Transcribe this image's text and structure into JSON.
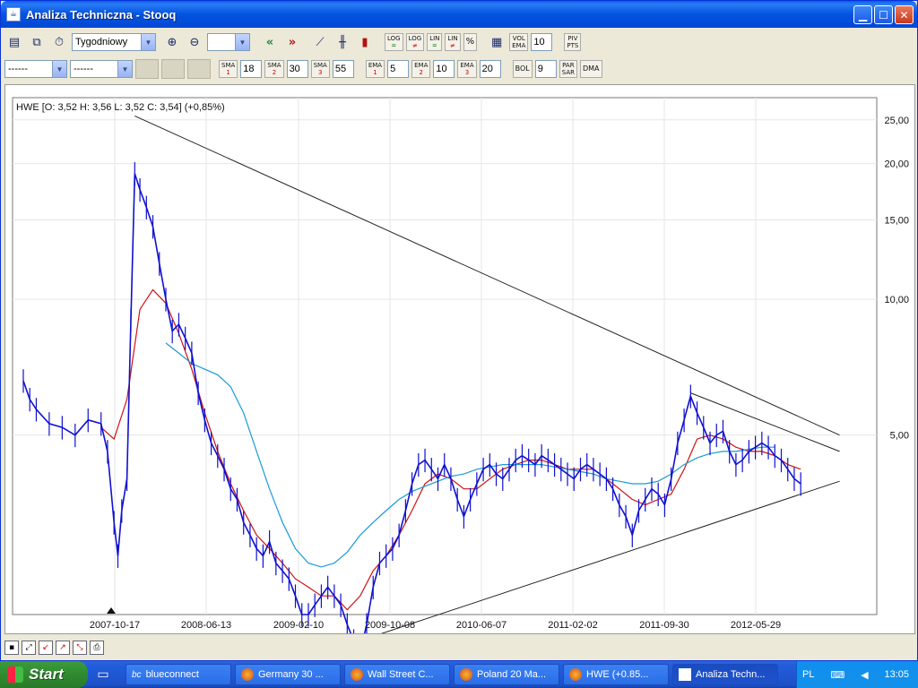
{
  "window": {
    "title": "Analiza Techniczna - Stooq"
  },
  "toolbar": {
    "interval": "Tygodniowy",
    "vol_ema_label_top": "VOL",
    "vol_ema_label_bottom": "EMA",
    "vol_ema_value": "10",
    "piv_label_top": "PIV",
    "piv_label_bottom": "PTS",
    "log1_top": "LOG",
    "log1_bottom": "=",
    "log2_top": "LOG",
    "log2_bottom": "≠",
    "lin1_top": "LIN",
    "lin1_bottom": "=",
    "lin2_top": "LIN",
    "lin2_bottom": "≠",
    "pct": "%"
  },
  "toolbar2": {
    "select1": "------",
    "select2": "------",
    "sma1": {
      "label": "SMA",
      "idx": "1",
      "value": "18"
    },
    "sma2": {
      "label": "SMA",
      "idx": "2",
      "value": "30"
    },
    "sma3": {
      "label": "SMA",
      "idx": "3",
      "value": "55"
    },
    "ema1": {
      "label": "EMA",
      "idx": "1",
      "value": "5"
    },
    "ema2": {
      "label": "EMA",
      "idx": "2",
      "value": "10"
    },
    "ema3": {
      "label": "EMA",
      "idx": "3",
      "value": "20"
    },
    "bol": {
      "label": "BOL",
      "value": "9"
    },
    "parsar_top": "PAR",
    "parsar_bottom": "SAR",
    "dma": "DMA"
  },
  "chart": {
    "legend": "HWE [O: 3,52  H: 3,56  L: 3,52  C: 3,54] (+0,85%)",
    "y_ticks": [
      "25,00",
      "20,00",
      "15,00",
      "10,00",
      "5,00"
    ],
    "x_ticks": [
      "2007-10-17",
      "2008-06-13",
      "2009-02-10",
      "2009-10-08",
      "2010-06-07",
      "2011-02-02",
      "2011-09-30",
      "2012-05-29"
    ]
  },
  "chart_data": {
    "type": "line",
    "title": "",
    "symbol": "HWE",
    "scale": "log",
    "ylim": [
      2.0,
      28.0
    ],
    "yticks": [
      25.0,
      20.0,
      15.0,
      10.0,
      5.0
    ],
    "xlabel": "",
    "ylabel": "",
    "x_ticks": [
      "2007-10-17",
      "2008-06-13",
      "2009-02-10",
      "2009-10-08",
      "2010-06-07",
      "2011-02-02",
      "2011-09-30",
      "2012-05-29"
    ],
    "ohlc_last": {
      "O": 3.52,
      "H": 3.56,
      "L": 3.52,
      "C": 3.54,
      "change_pct": 0.85
    },
    "series": [
      {
        "color": "#1010d0",
        "kind": "price",
        "points": [
          [
            0,
            6.6
          ],
          [
            5,
            6.0
          ],
          [
            10,
            5.7
          ],
          [
            20,
            5.3
          ],
          [
            30,
            5.2
          ],
          [
            40,
            5.0
          ],
          [
            50,
            5.4
          ],
          [
            60,
            5.3
          ],
          [
            65,
            4.6
          ],
          [
            70,
            3.2
          ],
          [
            73,
            2.7
          ],
          [
            76,
            3.4
          ],
          [
            80,
            4.0
          ],
          [
            83,
            9.0
          ],
          [
            86,
            19.0
          ],
          [
            90,
            17.5
          ],
          [
            95,
            16.0
          ],
          [
            100,
            14.5
          ],
          [
            105,
            12.0
          ],
          [
            110,
            10.0
          ],
          [
            115,
            8.5
          ],
          [
            120,
            8.8
          ],
          [
            125,
            8.2
          ],
          [
            130,
            7.6
          ],
          [
            135,
            6.2
          ],
          [
            140,
            5.4
          ],
          [
            145,
            4.8
          ],
          [
            150,
            4.5
          ],
          [
            155,
            4.2
          ],
          [
            160,
            3.8
          ],
          [
            165,
            3.6
          ],
          [
            170,
            3.2
          ],
          [
            175,
            3.0
          ],
          [
            180,
            2.8
          ],
          [
            185,
            2.7
          ],
          [
            190,
            2.9
          ],
          [
            195,
            2.6
          ],
          [
            200,
            2.5
          ],
          [
            205,
            2.4
          ],
          [
            210,
            2.2
          ],
          [
            215,
            2.0
          ],
          [
            220,
            2.0
          ],
          [
            225,
            2.1
          ],
          [
            230,
            2.2
          ],
          [
            235,
            2.3
          ],
          [
            240,
            2.2
          ],
          [
            245,
            2.1
          ],
          [
            250,
            1.9
          ],
          [
            255,
            1.75
          ],
          [
            260,
            1.65
          ],
          [
            265,
            1.9
          ],
          [
            270,
            2.3
          ],
          [
            275,
            2.6
          ],
          [
            280,
            2.7
          ],
          [
            285,
            2.8
          ],
          [
            290,
            3.0
          ],
          [
            295,
            3.4
          ],
          [
            300,
            3.9
          ],
          [
            305,
            4.3
          ],
          [
            310,
            4.4
          ],
          [
            315,
            4.2
          ],
          [
            320,
            4.0
          ],
          [
            325,
            4.3
          ],
          [
            330,
            4.0
          ],
          [
            335,
            3.6
          ],
          [
            340,
            3.3
          ],
          [
            345,
            3.6
          ],
          [
            350,
            3.9
          ],
          [
            355,
            4.2
          ],
          [
            360,
            4.3
          ],
          [
            365,
            4.1
          ],
          [
            370,
            4.0
          ],
          [
            375,
            4.2
          ],
          [
            380,
            4.4
          ],
          [
            385,
            4.5
          ],
          [
            390,
            4.4
          ],
          [
            395,
            4.3
          ],
          [
            400,
            4.5
          ],
          [
            405,
            4.4
          ],
          [
            410,
            4.3
          ],
          [
            415,
            4.2
          ],
          [
            420,
            4.1
          ],
          [
            425,
            4.0
          ],
          [
            430,
            4.2
          ],
          [
            435,
            4.3
          ],
          [
            440,
            4.2
          ],
          [
            445,
            4.1
          ],
          [
            450,
            4.0
          ],
          [
            455,
            3.8
          ],
          [
            460,
            3.5
          ],
          [
            465,
            3.3
          ],
          [
            470,
            3.0
          ],
          [
            475,
            3.4
          ],
          [
            480,
            3.6
          ],
          [
            485,
            3.8
          ],
          [
            490,
            3.7
          ],
          [
            495,
            3.5
          ],
          [
            500,
            4.0
          ],
          [
            505,
            4.8
          ],
          [
            510,
            5.4
          ],
          [
            515,
            6.1
          ],
          [
            520,
            5.6
          ],
          [
            525,
            5.2
          ],
          [
            530,
            4.8
          ],
          [
            535,
            5.0
          ],
          [
            540,
            5.1
          ],
          [
            545,
            4.6
          ],
          [
            550,
            4.3
          ],
          [
            555,
            4.4
          ],
          [
            560,
            4.6
          ],
          [
            565,
            4.7
          ],
          [
            570,
            4.8
          ],
          [
            575,
            4.7
          ],
          [
            580,
            4.5
          ],
          [
            585,
            4.4
          ],
          [
            590,
            4.2
          ],
          [
            595,
            4.0
          ],
          [
            600,
            3.9
          ]
        ]
      },
      {
        "color": "#d01010",
        "kind": "ma",
        "points": [
          [
            60,
            5.2
          ],
          [
            70,
            4.9
          ],
          [
            80,
            6.0
          ],
          [
            90,
            9.5
          ],
          [
            100,
            10.5
          ],
          [
            110,
            9.8
          ],
          [
            120,
            8.4
          ],
          [
            130,
            7.0
          ],
          [
            140,
            5.6
          ],
          [
            150,
            4.6
          ],
          [
            160,
            3.9
          ],
          [
            170,
            3.4
          ],
          [
            180,
            3.0
          ],
          [
            190,
            2.8
          ],
          [
            200,
            2.6
          ],
          [
            210,
            2.4
          ],
          [
            220,
            2.3
          ],
          [
            230,
            2.2
          ],
          [
            240,
            2.2
          ],
          [
            250,
            2.05
          ],
          [
            260,
            2.2
          ],
          [
            270,
            2.5
          ],
          [
            280,
            2.7
          ],
          [
            290,
            3.0
          ],
          [
            300,
            3.4
          ],
          [
            310,
            3.9
          ],
          [
            320,
            4.1
          ],
          [
            330,
            4.0
          ],
          [
            340,
            3.8
          ],
          [
            350,
            3.8
          ],
          [
            360,
            4.0
          ],
          [
            370,
            4.2
          ],
          [
            380,
            4.3
          ],
          [
            390,
            4.4
          ],
          [
            400,
            4.4
          ],
          [
            410,
            4.3
          ],
          [
            420,
            4.2
          ],
          [
            430,
            4.2
          ],
          [
            440,
            4.2
          ],
          [
            450,
            4.0
          ],
          [
            460,
            3.8
          ],
          [
            470,
            3.6
          ],
          [
            480,
            3.5
          ],
          [
            490,
            3.6
          ],
          [
            500,
            3.7
          ],
          [
            510,
            4.2
          ],
          [
            520,
            4.9
          ],
          [
            530,
            5.0
          ],
          [
            540,
            4.9
          ],
          [
            550,
            4.7
          ],
          [
            560,
            4.6
          ],
          [
            570,
            4.6
          ],
          [
            580,
            4.5
          ],
          [
            590,
            4.3
          ],
          [
            600,
            4.2
          ]
        ]
      },
      {
        "color": "#1a9ad6",
        "kind": "ma",
        "points": [
          [
            110,
            8.0
          ],
          [
            120,
            7.6
          ],
          [
            130,
            7.2
          ],
          [
            140,
            7.0
          ],
          [
            150,
            6.8
          ],
          [
            160,
            6.4
          ],
          [
            170,
            5.6
          ],
          [
            180,
            4.6
          ],
          [
            190,
            3.8
          ],
          [
            200,
            3.2
          ],
          [
            210,
            2.8
          ],
          [
            220,
            2.6
          ],
          [
            230,
            2.55
          ],
          [
            240,
            2.6
          ],
          [
            250,
            2.75
          ],
          [
            260,
            3.0
          ],
          [
            270,
            3.2
          ],
          [
            280,
            3.4
          ],
          [
            290,
            3.6
          ],
          [
            300,
            3.75
          ],
          [
            310,
            3.85
          ],
          [
            320,
            3.95
          ],
          [
            330,
            4.05
          ],
          [
            340,
            4.1
          ],
          [
            350,
            4.2
          ],
          [
            360,
            4.25
          ],
          [
            370,
            4.3
          ],
          [
            380,
            4.3
          ],
          [
            390,
            4.3
          ],
          [
            400,
            4.3
          ],
          [
            410,
            4.25
          ],
          [
            420,
            4.2
          ],
          [
            430,
            4.15
          ],
          [
            440,
            4.1
          ],
          [
            450,
            4.0
          ],
          [
            460,
            3.95
          ],
          [
            470,
            3.9
          ],
          [
            480,
            3.9
          ],
          [
            490,
            3.95
          ],
          [
            500,
            4.1
          ],
          [
            510,
            4.3
          ],
          [
            520,
            4.45
          ],
          [
            530,
            4.55
          ],
          [
            540,
            4.6
          ],
          [
            550,
            4.6
          ],
          [
            560,
            4.65
          ],
          [
            570,
            4.7
          ],
          [
            580,
            4.7
          ]
        ]
      }
    ],
    "trendlines": [
      {
        "color": "#222222",
        "from": [
          86,
          25.5
        ],
        "to": [
          630,
          5.0
        ]
      },
      {
        "color": "#222222",
        "from": [
          260,
          1.75
        ],
        "to": [
          630,
          3.95
        ]
      },
      {
        "color": "#222222",
        "from": [
          515,
          6.2
        ],
        "to": [
          630,
          4.6
        ]
      }
    ]
  },
  "taskbar": {
    "start": "Start",
    "items": [
      "blueconnect",
      "Germany 30 ...",
      "Wall Street C...",
      "Poland 20 Ma...",
      "HWE (+0.85...",
      "Analiza Techn..."
    ],
    "lang": "PL",
    "clock": "13:05"
  }
}
